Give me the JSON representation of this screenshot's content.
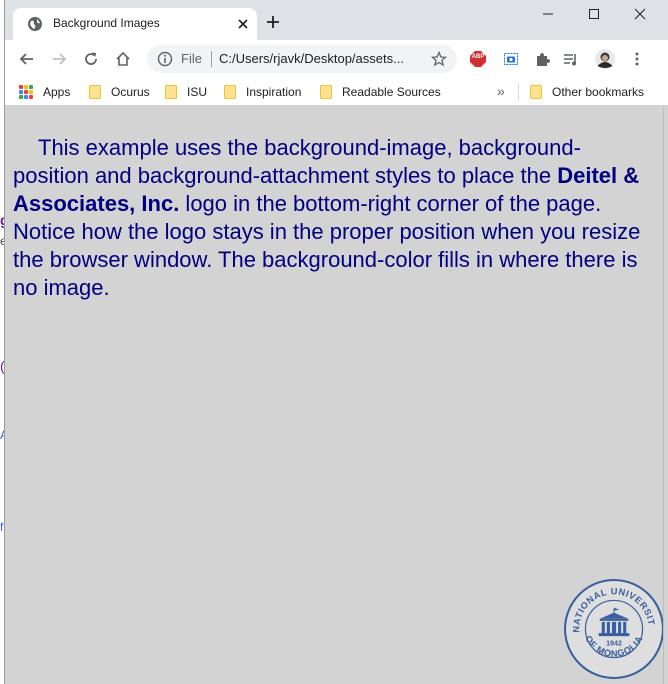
{
  "tab": {
    "title": "Background Images"
  },
  "toolbar": {
    "omnibox_scheme": "File",
    "omnibox_url": "C:/Users/rjavk/Desktop/assets...",
    "abp_label": "ABP"
  },
  "bookmarks": {
    "apps_label": "Apps",
    "items": [
      {
        "label": "Ocurus"
      },
      {
        "label": "ISU"
      },
      {
        "label": "Inspiration"
      },
      {
        "label": "Readable Sources"
      }
    ],
    "overflow_label": "»",
    "other_label": "Other bookmarks"
  },
  "content": {
    "para_before": "This example uses the background-image, background-position and background-attachment styles to place the ",
    "para_bold": "Deitel & Associates, Inc.",
    "para_after": " logo in the bottom-right corner of the page. Notice how the logo stays in the proper position when you resize the browser window. The background-color fills in where there is no image.",
    "background_color": "#d3d3d3",
    "text_color": "#000080"
  },
  "logo": {
    "top_text": "NATIONAL UNIVERSITY",
    "bottom_text": "OF MONGOLIA",
    "year": "1942",
    "color": "#3a5fa0"
  },
  "underlying_fragments": [
    "g",
    "e",
    "(",
    "A",
    "f"
  ]
}
